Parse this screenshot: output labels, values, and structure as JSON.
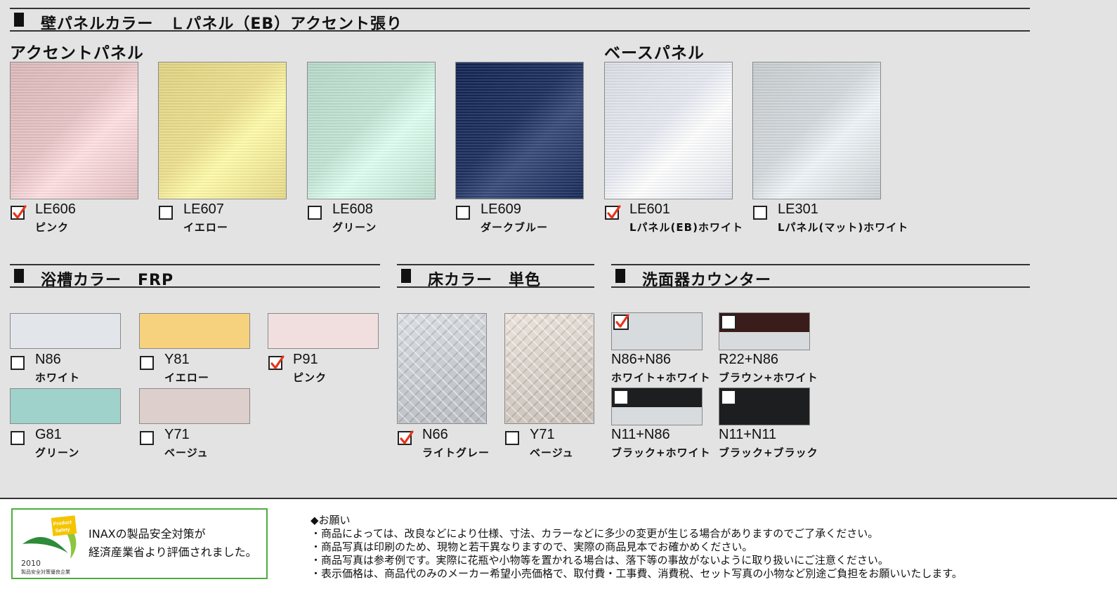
{
  "wall": {
    "title": "壁パネルカラー　Ｌパネル（EB）アクセント張り",
    "accent_label": "アクセントパネル",
    "base_label": "ベースパネル",
    "items": [
      {
        "code": "LE606",
        "name": "ピンク",
        "checked": true,
        "color": "#e8c4c6"
      },
      {
        "code": "LE607",
        "name": "イエロー",
        "checked": false,
        "color": "#ecdf8e"
      },
      {
        "code": "LE608",
        "name": "グリーン",
        "checked": false,
        "color": "#c2e4d5"
      },
      {
        "code": "LE609",
        "name": "ダークブルー",
        "checked": false,
        "color": "#1d2f5e"
      },
      {
        "code": "LE601",
        "name": "Lパネル(EB)ホワイト",
        "checked": true,
        "color": "#e6e9f1"
      },
      {
        "code": "LE301",
        "name": "Lパネル(マット)ホワイト",
        "checked": false,
        "color": "#d3d9dc"
      }
    ]
  },
  "tub": {
    "title": "浴槽カラー　FRP",
    "items": [
      {
        "code": "N86",
        "name": "ホワイト",
        "checked": false,
        "color": "#e2e5e9"
      },
      {
        "code": "Y81",
        "name": "イエロー",
        "checked": false,
        "color": "#f6d27e"
      },
      {
        "code": "P91",
        "name": "ピンク",
        "checked": true,
        "color": "#f1dfe0"
      },
      {
        "code": "G81",
        "name": "グリーン",
        "checked": false,
        "color": "#a0d2cc"
      },
      {
        "code": "Y71",
        "name": "ベージュ",
        "checked": false,
        "color": "#dccfcc"
      }
    ]
  },
  "floor": {
    "title": "床カラー　単色",
    "items": [
      {
        "code": "N66",
        "name": "ライトグレー",
        "checked": true,
        "color": "#c8ccd0"
      },
      {
        "code": "Y71",
        "name": "ベージュ",
        "checked": false,
        "color": "#d8d0c8"
      }
    ]
  },
  "counter": {
    "title": "洗面器カウンター",
    "items": [
      {
        "code": "N86+N86",
        "name": "ホワイト+ホワイト",
        "checked": true,
        "top": "#d8dbde",
        "bottom": "#d8dbde"
      },
      {
        "code": "R22+N86",
        "name": "ブラウン+ホワイト",
        "checked": false,
        "top": "#3a1c1a",
        "bottom": "#d8dbde"
      },
      {
        "code": "N11+N86",
        "name": "ブラック+ホワイト",
        "checked": false,
        "top": "#1c1e20",
        "bottom": "#d8dbde"
      },
      {
        "code": "N11+N11",
        "name": "ブラック+ブラック",
        "checked": false,
        "top": "#1c1e20",
        "bottom": "#1c1e20"
      }
    ]
  },
  "footer": {
    "badge": {
      "logo_text": "Product Safety",
      "line1": "INAXの製品安全対策が",
      "line2": "経済産業省より評価されました。",
      "year": "2010",
      "sub": "製品安全対策優良企業"
    },
    "notes": {
      "heading": "◆お願い",
      "lines": [
        "・商品によっては、改良などにより仕様、寸法、カラーなどに多少の変更が生じる場合がありますのでご了承ください。",
        "・商品写真は印刷のため、現物と若干異なりますので、実際の商品見本でお確かめください。",
        "・商品写真は参考例です。実際に花瓶や小物等を置かれる場合は、落下等の事故がないように取り扱いにご注意ください。",
        "・表示価格は、商品代のみのメーカー希望小売価格で、取付費・工事費、消費税、セット写真の小物など別途ご負担をお願いいたします。"
      ]
    },
    "colors": {
      "check": "#e8331c",
      "badge_green": "#4cae3c"
    }
  }
}
